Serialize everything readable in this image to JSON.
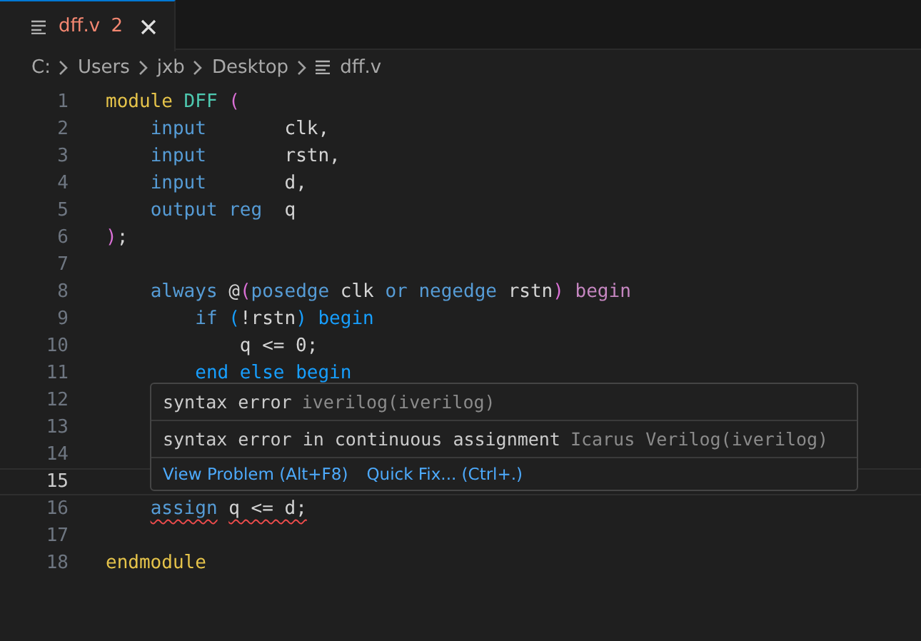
{
  "tabs": [
    {
      "label": "dff.v",
      "problems": "2",
      "has_errors": true,
      "selected": true
    }
  ],
  "breadcrumb": [
    {
      "label": "C:",
      "kind": "folder"
    },
    {
      "label": "Users",
      "kind": "folder"
    },
    {
      "label": "jxb",
      "kind": "folder"
    },
    {
      "label": "Desktop",
      "kind": "folder"
    },
    {
      "label": "dff.v",
      "kind": "file"
    }
  ],
  "editor": {
    "lines": [
      {
        "number": "1",
        "current": false,
        "tokens": [
          {
            "text": "module",
            "kind": "module"
          },
          {
            "text": " DFF",
            "kind": "type"
          },
          {
            "text": " (",
            "kind": "bracket1"
          }
        ]
      },
      {
        "number": "2",
        "current": false,
        "tokens": [
          {
            "text": "    input",
            "kind": "keyword"
          },
          {
            "text": "       clk,",
            "kind": "plain"
          }
        ]
      },
      {
        "number": "3",
        "current": false,
        "tokens": [
          {
            "text": "    input",
            "kind": "keyword"
          },
          {
            "text": "       rstn,",
            "kind": "plain"
          }
        ]
      },
      {
        "number": "4",
        "current": false,
        "tokens": [
          {
            "text": "    input",
            "kind": "keyword"
          },
          {
            "text": "       d,",
            "kind": "plain"
          }
        ]
      },
      {
        "number": "5",
        "current": false,
        "tokens": [
          {
            "text": "    output reg",
            "kind": "keyword"
          },
          {
            "text": "  q",
            "kind": "plain"
          }
        ]
      },
      {
        "number": "6",
        "current": false,
        "tokens": [
          {
            "text": ")",
            "kind": "bracket1"
          },
          {
            "text": ";",
            "kind": "plain"
          }
        ]
      },
      {
        "number": "7",
        "current": false
      },
      {
        "number": "8",
        "current": false,
        "tokens": [
          {
            "text": "    always",
            "kind": "keyword"
          },
          {
            "text": " @",
            "kind": "plain"
          },
          {
            "text": "(",
            "kind": "bracket1"
          },
          {
            "text": "posedge",
            "kind": "keyword"
          },
          {
            "text": " clk",
            "kind": "plain"
          },
          {
            "text": " or",
            "kind": "keyword"
          },
          {
            "text": " negedge",
            "kind": "keyword"
          },
          {
            "text": " rstn",
            "kind": "plain"
          },
          {
            "text": ")",
            "kind": "bracket1"
          },
          {
            "text": " begin",
            "kind": "control"
          }
        ]
      },
      {
        "number": "9",
        "current": false,
        "tokens": [
          {
            "text": "        if",
            "kind": "keyword"
          },
          {
            "text": " (",
            "kind": "bracket2"
          },
          {
            "text": "!rstn",
            "kind": "plain"
          },
          {
            "text": ")",
            "kind": "bracket2"
          },
          {
            "text": " begin",
            "kind": "bracket2"
          }
        ]
      },
      {
        "number": "10",
        "current": false,
        "tokens": [
          {
            "text": "            q <= 0;",
            "kind": "plain"
          }
        ]
      },
      {
        "number": "11",
        "current": false,
        "tokens": [
          {
            "text": "        end else begin",
            "kind": "bracket2"
          }
        ]
      },
      {
        "number": "12",
        "current": false
      },
      {
        "number": "13",
        "current": false
      },
      {
        "number": "14",
        "current": false
      },
      {
        "number": "15",
        "current": true
      },
      {
        "number": "16",
        "current": false,
        "tokens": [
          {
            "text": "    assign",
            "kind": "keyword",
            "error": true
          },
          {
            "text": " q <= d;",
            "kind": "plain",
            "error": true
          }
        ]
      },
      {
        "number": "17",
        "current": false
      },
      {
        "number": "18",
        "current": false,
        "tokens": [
          {
            "text": "endmodule",
            "kind": "module"
          }
        ]
      }
    ]
  },
  "hover": {
    "problems": [
      {
        "message": "syntax error",
        "source": "iverilog(iverilog)"
      },
      {
        "message": "syntax error in continuous assignment",
        "source": "Icarus Verilog(iverilog)"
      }
    ],
    "actions": [
      "View Problem (Alt+F8)",
      "Quick Fix... (Ctrl+.)"
    ]
  }
}
